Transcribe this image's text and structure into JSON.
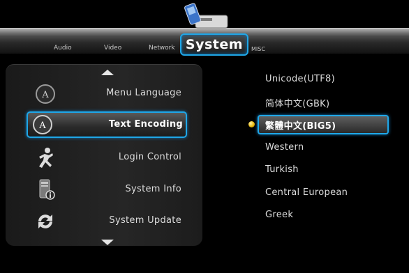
{
  "tabs": [
    {
      "label": "Audio"
    },
    {
      "label": "Video"
    },
    {
      "label": "Network"
    },
    {
      "label": "System"
    },
    {
      "label": "MISC"
    }
  ],
  "menu": {
    "items": [
      {
        "label": "Menu Language",
        "icon": "language-icon"
      },
      {
        "label": "Text Encoding",
        "icon": "language-icon",
        "selected": true
      },
      {
        "label": "Login Control",
        "icon": "running-man-icon"
      },
      {
        "label": "System Info",
        "icon": "system-info-icon"
      },
      {
        "label": "System Update",
        "icon": "update-icon"
      }
    ]
  },
  "encoding_options": [
    {
      "label": "Unicode(UTF8)"
    },
    {
      "label": "简体中文(GBK)"
    },
    {
      "label": "繁體中文(BIG5)",
      "selected": true
    },
    {
      "label": "Western"
    },
    {
      "label": "Turkish"
    },
    {
      "label": "Central European"
    },
    {
      "label": "Greek"
    }
  ],
  "colors": {
    "accent": "#1fa7e8",
    "radio": "#e8b400",
    "background": "#000000"
  }
}
